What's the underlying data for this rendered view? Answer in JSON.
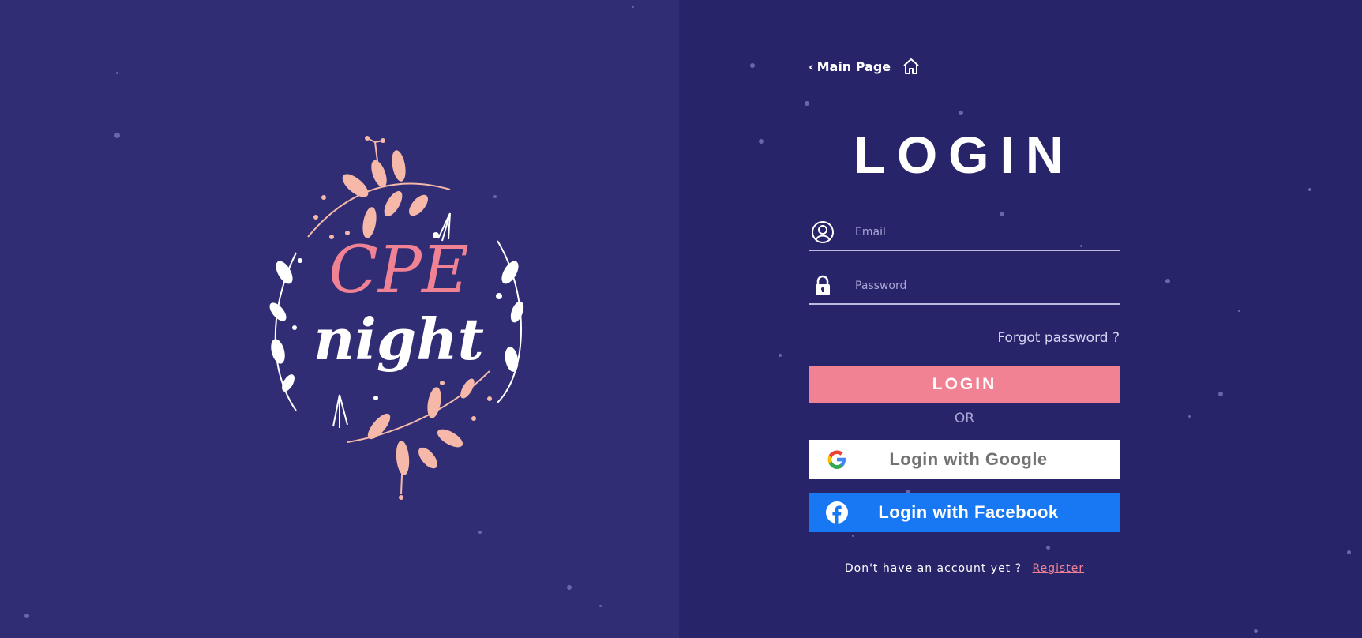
{
  "nav": {
    "back_label": "Main Page",
    "back_chevron": "‹",
    "home_icon": "home-icon"
  },
  "form": {
    "title": "LOGIN",
    "email": {
      "placeholder": "Email",
      "value": "",
      "icon": "user-circle-icon"
    },
    "password": {
      "placeholder": "Password",
      "value": "",
      "icon": "lock-icon"
    },
    "forgot_label": "Forgot password ?",
    "login_label": "LOGIN",
    "or_label": "OR",
    "google_label": "Login with Google",
    "facebook_label": "Login with Facebook",
    "no_account_label": "Don't have an account yet ?",
    "register_label": "Register"
  },
  "logo": {
    "line1": "CPE",
    "line2": "night"
  },
  "colors": {
    "left_bg": "#312d74",
    "right_bg": "#27246a",
    "accent_pink": "#f08294",
    "facebook_blue": "#1877f2",
    "google_bg": "#ffffff"
  }
}
